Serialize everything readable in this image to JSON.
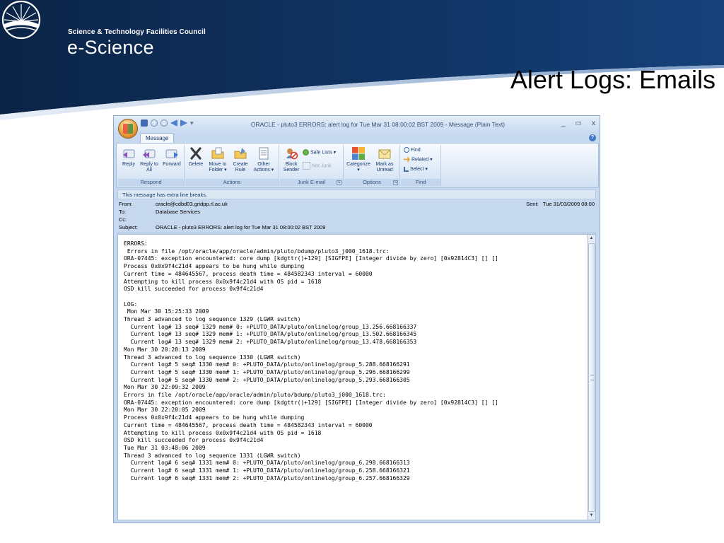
{
  "slide": {
    "org_name": "Science & Technology Facilities Council",
    "brand": "e-Science",
    "title": "Alert Logs: Emails"
  },
  "window": {
    "title": "ORACLE - pluto3 ERRORS: alert log for Tue Mar 31 08:00:02 BST 2009  -  Message (Plain Text)",
    "controls": {
      "minimize": "_",
      "maximize": "▭",
      "close": "x"
    },
    "help": "?"
  },
  "ribbon": {
    "tab": "Message",
    "groups": {
      "respond": "Respond",
      "actions": "Actions",
      "junk": "Junk E-mail",
      "options": "Options",
      "find": "Find"
    },
    "buttons": {
      "reply": "Reply",
      "reply_all": "Reply to All",
      "forward": "Forward",
      "delete": "Delete",
      "move_to_folder": "Move to Folder ▾",
      "create_rule": "Create Rule",
      "other_actions": "Other Actions ▾",
      "block_sender": "Block Sender",
      "safe_lists": "Safe Lists ▾",
      "not_junk": "Not Junk",
      "categorize": "Categorize ▾",
      "mark_unread": "Mark as Unread",
      "find": "Find",
      "related": "Related ▾",
      "select": "Select ▾"
    },
    "colors": {
      "accent": "#3f78c8",
      "ribbon_bg": "#dce8f6"
    }
  },
  "message": {
    "info_bar": "This message has extra line breaks.",
    "from_label": "From:",
    "from": "oracle@cdbd03.gridpp.rl.ac.uk",
    "to_label": "To:",
    "to": "Database Services",
    "cc_label": "Cc:",
    "cc": "",
    "subject_label": "Subject:",
    "subject": "ORACLE - pluto3 ERRORS: alert log for Tue Mar 31 08:00:02 BST 2009",
    "sent_label": "Sent:",
    "sent": "Tue 31/03/2009 08:00",
    "body": "ERRORS:\n Errors in file /opt/oracle/app/oracle/admin/pluto/bdump/pluto3_j000_1618.trc:\nORA-07445: exception encountered: core dump [kdgttr()+129] [SIGFPE] [Integer divide by zero] [0x92814C3] [] []\nProcess 0x0x9f4c21d4 appears to be hung while dumping\nCurrent time = 484645567, process death time = 484582343 interval = 60000\nAttempting to kill process 0x0x9f4c21d4 with OS pid = 1618\nOSD kill succeeded for process 0x9f4c21d4\n\nLOG:\n Mon Mar 30 15:25:33 2009\nThread 3 advanced to log sequence 1329 (LGWR switch)\n  Current log# 13 seq# 1329 mem# 0: +PLUTO_DATA/pluto/onlinelog/group_13.256.668166337\n  Current log# 13 seq# 1329 mem# 1: +PLUTO_DATA/pluto/onlinelog/group_13.502.668166345\n  Current log# 13 seq# 1329 mem# 2: +PLUTO_DATA/pluto/onlinelog/group_13.478.668166353\nMon Mar 30 20:28:13 2009\nThread 3 advanced to log sequence 1330 (LGWR switch)\n  Current log# 5 seq# 1330 mem# 0: +PLUTO_DATA/pluto/onlinelog/group_5.288.668166291\n  Current log# 5 seq# 1330 mem# 1: +PLUTO_DATA/pluto/onlinelog/group_5.296.668166299\n  Current log# 5 seq# 1330 mem# 2: +PLUTO_DATA/pluto/onlinelog/group_5.293.668166305\nMon Mar 30 22:09:32 2009\nErrors in file /opt/oracle/app/oracle/admin/pluto/bdump/pluto3_j000_1618.trc:\nORA-07445: exception encountered: core dump [kdgttr()+129] [SIGFPE] [Integer divide by zero] [0x92814C3] [] []\nMon Mar 30 22:20:05 2009\nProcess 0x0x9f4c21d4 appears to be hung while dumping\nCurrent time = 484645567, process death time = 484582343 interval = 60000\nAttempting to kill process 0x0x9f4c21d4 with OS pid = 1618\nOSD kill succeeded for process 0x9f4c21d4\nTue Mar 31 03:48:06 2009\nThread 3 advanced to log sequence 1331 (LGWR switch)\n  Current log# 6 seq# 1331 mem# 0: +PLUTO_DATA/pluto/onlinelog/group_6.298.668166313\n  Current log# 6 seq# 1331 mem# 1: +PLUTO_DATA/pluto/onlinelog/group_6.258.668166321\n  Current log# 6 seq# 1331 mem# 2: +PLUTO_DATA/pluto/onlinelog/group_6.257.668166329"
  },
  "colors": {
    "navy": "#0d2a52",
    "header_blue": "#113a6e"
  }
}
